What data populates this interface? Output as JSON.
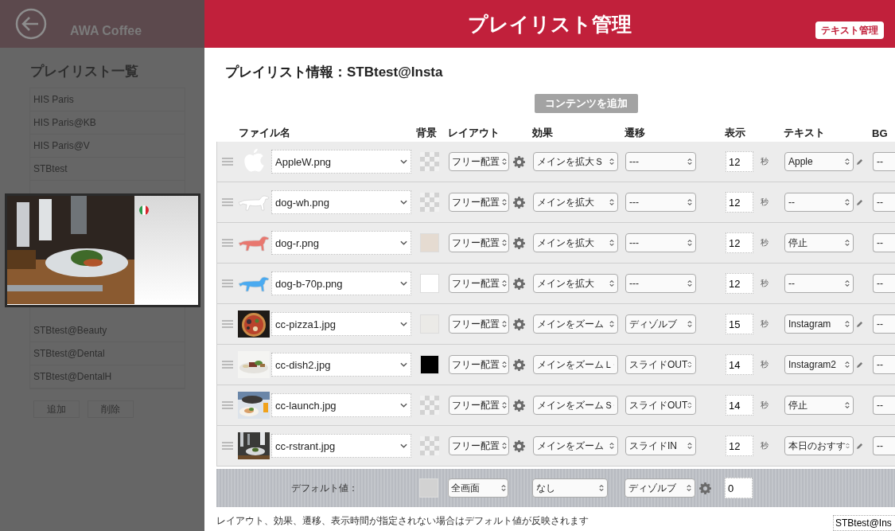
{
  "sidebar": {
    "shop": "AWA Coffee",
    "title": "プレイリスト一覧",
    "items": [
      {
        "label": "HIS Paris"
      },
      {
        "label": "HIS Paris@KB"
      },
      {
        "label": "HIS Paris@V"
      },
      {
        "label": "STBtest"
      }
    ],
    "preview": {
      "shown": true
    },
    "items_below": [
      {
        "label": "STBtest@Beauty"
      },
      {
        "label": "STBtest@Dental"
      },
      {
        "label": "STBtest@DentalH"
      }
    ],
    "buttons": [
      "追加",
      "削除"
    ]
  },
  "header": {
    "title": "プレイリスト管理",
    "button": "テキスト管理"
  },
  "playlist_title": "プレイリスト情報：STBtest@Insta",
  "add_button": "コンテンツを追加",
  "columns": [
    "ファイル名",
    "背景",
    "レイアウト",
    "効果",
    "遷移",
    "表示",
    "テキスト",
    "BG"
  ],
  "rows": [
    {
      "file": "AppleW.png",
      "thumb": {
        "kind": "apple"
      },
      "bg": {
        "kind": "checker"
      },
      "layout": "フリー配置",
      "effect": "メインを拡大Ｓ",
      "transition": "---",
      "duration": "12",
      "unit": "秒",
      "text": "Apple",
      "edit": true,
      "bgm": "--"
    },
    {
      "file": "dog-wh.png",
      "thumb": {
        "kind": "dog",
        "color": "#ffffff"
      },
      "bg": {
        "kind": "checker"
      },
      "layout": "フリー配置",
      "effect": "メインを拡大",
      "transition": "---",
      "duration": "12",
      "unit": "秒",
      "text": "--",
      "edit": true,
      "bgm": "--"
    },
    {
      "file": "dog-r.png",
      "thumb": {
        "kind": "dog",
        "color": "#e8776f"
      },
      "bg": {
        "kind": "solid",
        "color": "#e5dbd1"
      },
      "layout": "フリー配置",
      "effect": "メインを拡大",
      "transition": "---",
      "duration": "12",
      "unit": "秒",
      "text": "停止",
      "edit": false,
      "bgm": "--"
    },
    {
      "file": "dog-b-70p.png",
      "thumb": {
        "kind": "dog",
        "color": "#4aaaf0"
      },
      "bg": {
        "kind": "solid",
        "color": "#ffffff"
      },
      "layout": "フリー配置",
      "effect": "メインを拡大",
      "transition": "---",
      "duration": "12",
      "unit": "秒",
      "text": "--",
      "edit": false,
      "bgm": "--"
    },
    {
      "file": "cc-pizza1.jpg",
      "bg": {
        "kind": "solid",
        "color": "#ebeae7"
      },
      "layout": "フリー配置",
      "effect": "メインをズーム",
      "transition": "ディゾルブ",
      "duration": "15",
      "unit": "秒",
      "text": "Instagram",
      "edit": true,
      "bgm": "--"
    },
    {
      "file": "cc-dish2.jpg",
      "bg": {
        "kind": "solid",
        "color": "#000000"
      },
      "layout": "フリー配置",
      "effect": "メインをズームＬ",
      "transition": "スライドOUT",
      "duration": "14",
      "unit": "秒",
      "text": "Instagram2",
      "edit": true,
      "bgm": "--"
    },
    {
      "file": "cc-launch.jpg",
      "bg": {
        "kind": "checker"
      },
      "layout": "フリー配置",
      "effect": "メインをズームＳ",
      "transition": "スライドOUT",
      "duration": "14",
      "unit": "秒",
      "text": "停止",
      "edit": false,
      "bgm": "--"
    },
    {
      "file": "cc-rstrant.jpg",
      "bg": {
        "kind": "checker"
      },
      "layout": "フリー配置",
      "effect": "メインをズーム",
      "transition": "スライドIN",
      "duration": "12",
      "unit": "秒",
      "text": "本日のおすす",
      "edit": true,
      "bgm": "--"
    }
  ],
  "defaults": {
    "label": "デフォルト値：",
    "bg": {
      "kind": "solid",
      "color": "#d2d2d2"
    },
    "layout": "全画面",
    "effect": "なし",
    "transition": "ディゾルブ",
    "duration": "0"
  },
  "note": "レイアウト、効果、遷移、表示時間が指定されない場合はデフォルト値が反映されます",
  "corner_field": "STBtest@Ins"
}
